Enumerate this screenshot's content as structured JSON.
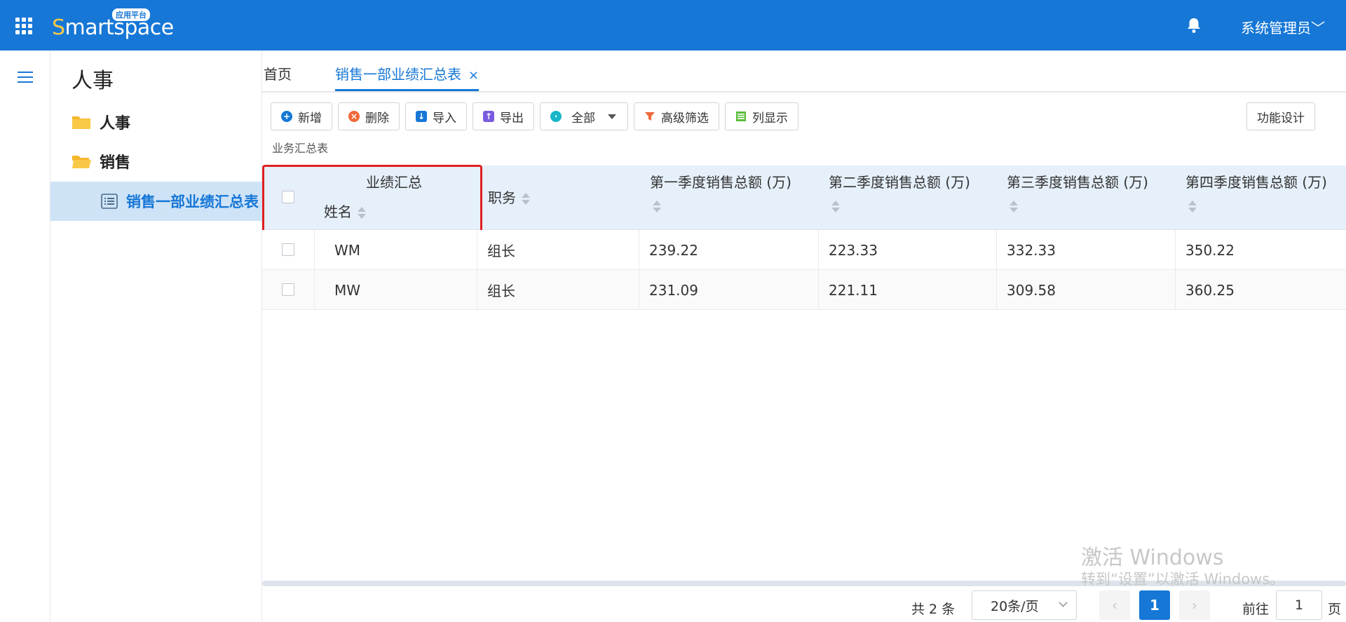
{
  "header": {
    "logo_first_letter": "S",
    "logo_rest": "martspace",
    "logo_badge": "应用平台",
    "user_name": "系统管理员",
    "user_caret": "﹀",
    "brand_color": "#1677d6"
  },
  "sidebar": {
    "module_title": "人事",
    "items": [
      {
        "label": "人事",
        "icon": "folder-icon"
      },
      {
        "label": "销售",
        "icon": "folder-open-icon"
      }
    ],
    "active_leaf": {
      "label": "销售一部业绩汇总表",
      "icon": "list-icon"
    }
  },
  "tabs": [
    {
      "label": "首页"
    },
    {
      "label": "销售一部业绩汇总表",
      "close": "×"
    }
  ],
  "toolbar": {
    "add": "新增",
    "delete": "删除",
    "import": "导入",
    "export": "导出",
    "all": "全部",
    "advanced_filter": "高级筛选",
    "column_display": "列显示",
    "design": "功能设计"
  },
  "subtitle": "业务汇总表",
  "table": {
    "group_header": "业绩汇总",
    "columns": {
      "name": "姓名",
      "role": "职务",
      "q1": "第一季度销售总额 (万)",
      "q2": "第二季度销售总额 (万)",
      "q3": "第三季度销售总额 (万)",
      "q4": "第四季度销售总额 (万)"
    },
    "rows": [
      {
        "name": "WM",
        "role": "组长",
        "q1": "239.22",
        "q2": "223.33",
        "q3": "332.33",
        "q4": "350.22"
      },
      {
        "name": "MW",
        "role": "组长",
        "q1": "231.09",
        "q2": "221.11",
        "q3": "309.58",
        "q4": "360.25"
      }
    ]
  },
  "pagination": {
    "total": "共 2 条",
    "page_size": "20条/页",
    "prev": "‹",
    "current": "1",
    "next": "›",
    "goto_label": "前往",
    "goto_value": "1",
    "goto_unit": "页"
  },
  "watermark": {
    "line1": "激活 Windows",
    "line2": "转到“设置”以激活 Windows。"
  }
}
